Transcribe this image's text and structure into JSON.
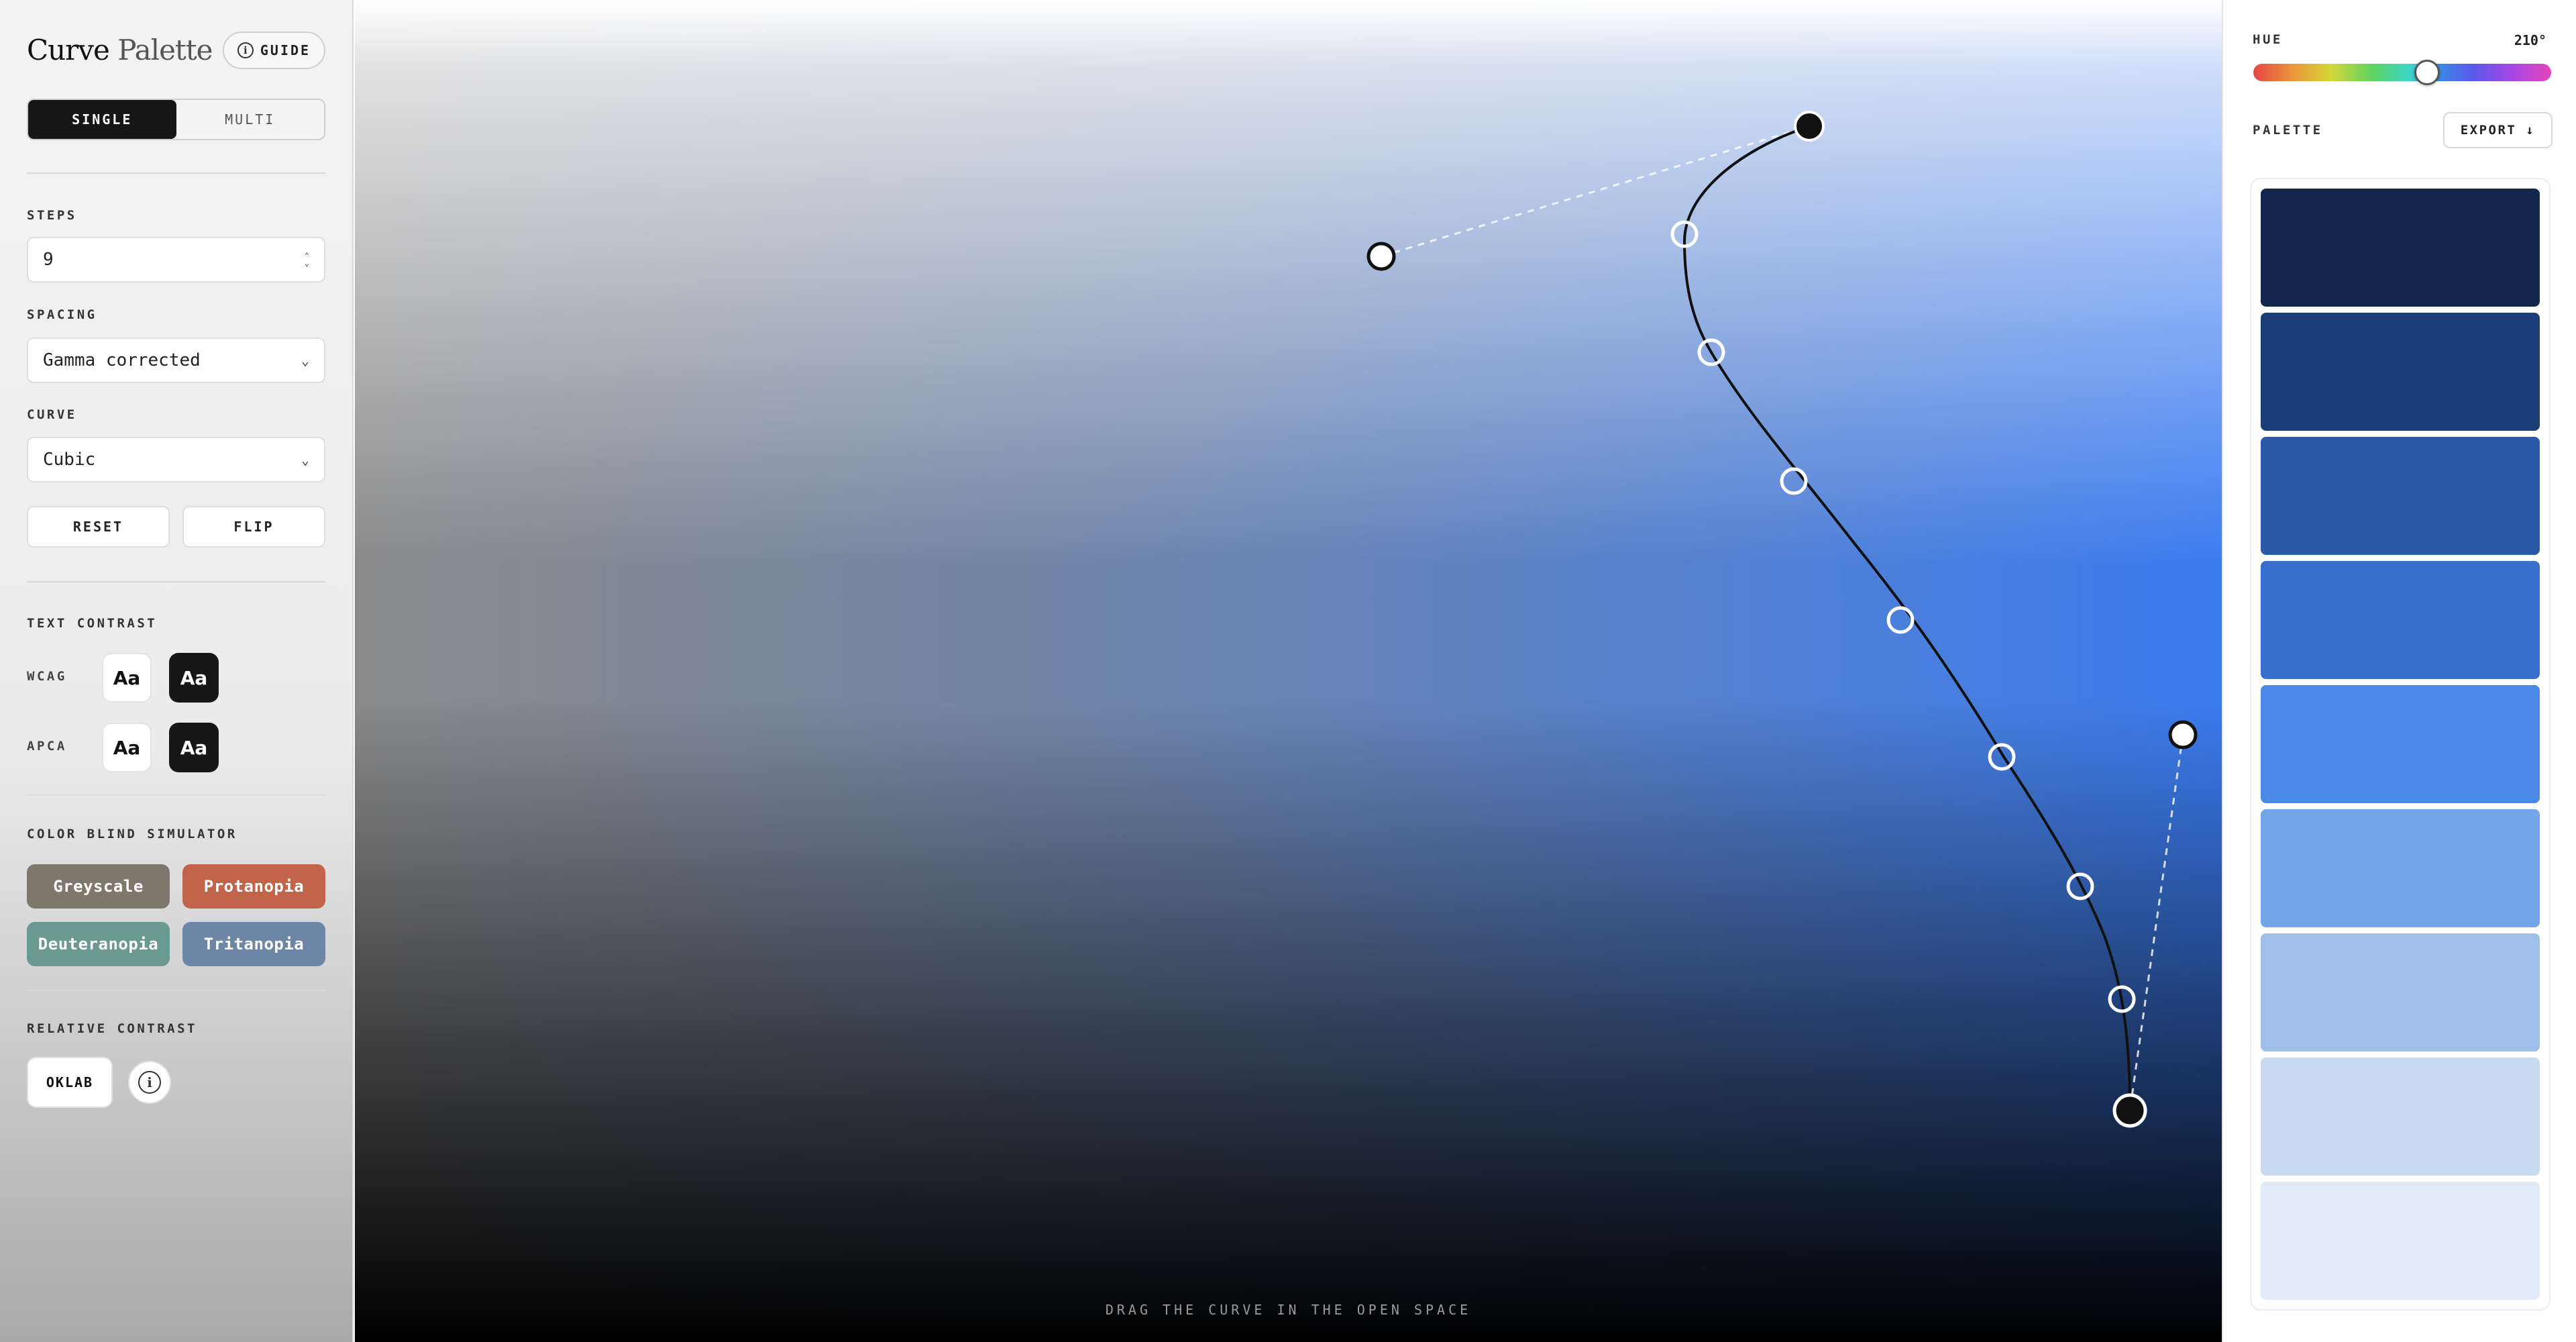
{
  "app": {
    "title_main": "Curve",
    "title_sub": "Palette",
    "guide_label": "GUIDE"
  },
  "mode": {
    "options": [
      "SINGLE",
      "MULTI"
    ],
    "selected": "SINGLE"
  },
  "controls": {
    "steps_label": "STEPS",
    "steps_value": "9",
    "spacing_label": "SPACING",
    "spacing_value": "Gamma corrected",
    "curve_label": "CURVE",
    "curve_value": "Cubic",
    "reset_label": "RESET",
    "flip_label": "FLIP"
  },
  "text_contrast": {
    "label": "TEXT CONTRAST",
    "wcag_label": "WCAG",
    "apca_label": "APCA",
    "sample": "Aa"
  },
  "color_blind": {
    "label": "COLOR BLIND SIMULATOR",
    "buttons": [
      {
        "label": "Greyscale",
        "color": "#7d776c"
      },
      {
        "label": "Protanopia",
        "color": "#c2644a"
      },
      {
        "label": "Deuteranopia",
        "color": "#6a9990"
      },
      {
        "label": "Tritanopia",
        "color": "#6d86a8"
      }
    ]
  },
  "relative_contrast": {
    "label": "RELATIVE CONTRAST",
    "value": "OKLAB"
  },
  "canvas": {
    "hint": "DRAG THE CURVE IN THE OPEN SPACE"
  },
  "hue": {
    "label": "HUE",
    "value": "210°",
    "fraction": 0.583
  },
  "palette": {
    "label": "PALETTE",
    "export_label": "EXPORT ↓",
    "swatches": [
      "#12264e",
      "#1a3d78",
      "#2a59a8",
      "#3a70cd",
      "#4a89e6",
      "#72a6e8",
      "#9dbfe9",
      "#c7daf1",
      "#e0ebf7"
    ]
  }
}
